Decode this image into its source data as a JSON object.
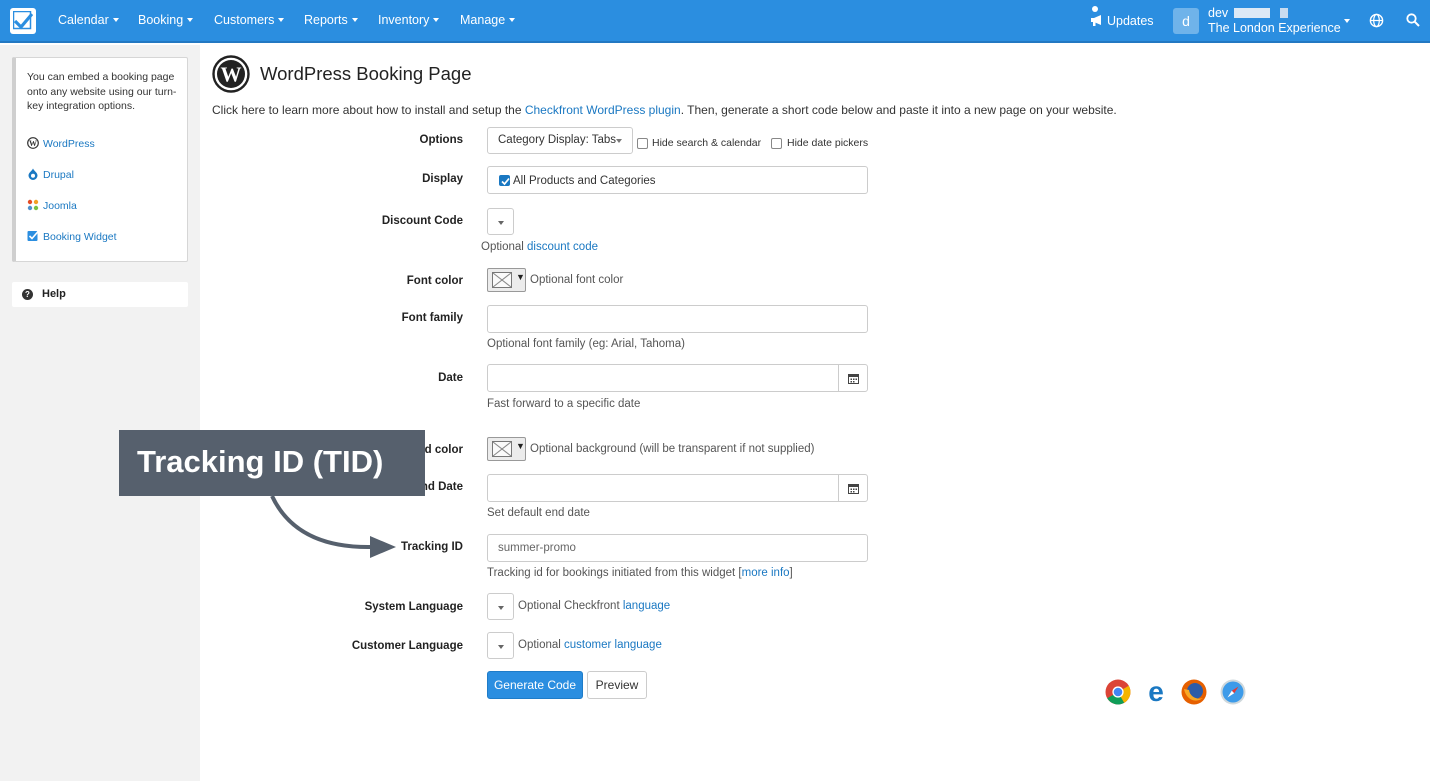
{
  "nav": {
    "items": [
      "Calendar",
      "Booking",
      "Customers",
      "Reports",
      "Inventory",
      "Manage"
    ],
    "updates_label": "Updates",
    "user_initial": "d",
    "user_name": "dev",
    "account_name": "The London Experience"
  },
  "sidebar": {
    "intro": "You can embed a booking page onto any website using our turn-key integration options.",
    "links": [
      "WordPress",
      "Drupal",
      "Joomla",
      "Booking Widget"
    ],
    "help_label": "Help"
  },
  "page": {
    "title": "WordPress Booking Page",
    "intro_before": "Click here to learn more about how to install and setup the ",
    "intro_link": "Checkfront WordPress plugin",
    "intro_after": ". Then, generate a short code below and paste it into a new page on your website."
  },
  "form": {
    "options_label": "Options",
    "options_select": "Category Display: Tabs",
    "hide_search_label": "Hide search & calendar",
    "hide_dates_label": "Hide date pickers",
    "display_label": "Display",
    "display_value": "All Products and Categories",
    "discount_label": "Discount Code",
    "discount_help_prefix": "Optional ",
    "discount_help_link": "discount code",
    "font_color_label": "Font color",
    "font_color_help": "Optional font color",
    "font_family_label": "Font family",
    "font_family_help": "Optional font family (eg: Arial, Tahoma)",
    "date_label": "Date",
    "date_help": "Fast forward to a specific date",
    "bg_color_label": "Background color",
    "bg_color_help": "Optional background (will be transparent if not supplied)",
    "end_date_label": "End Date",
    "end_date_help": "Set default end date",
    "tracking_label": "Tracking ID",
    "tracking_value": "summer-promo",
    "tracking_help_prefix": "Tracking id for bookings initiated from this widget [",
    "tracking_help_link": "more info",
    "tracking_help_suffix": "]",
    "system_lang_label": "System Language",
    "system_lang_prefix": "Optional Checkfront ",
    "system_lang_link": "language",
    "customer_lang_label": "Customer Language",
    "customer_lang_prefix": "Optional ",
    "customer_lang_link": "customer language",
    "generate_button": "Generate Code",
    "preview_button": "Preview"
  },
  "callout": {
    "text": "Tracking ID (TID)"
  },
  "colors": {
    "nav_bg": "#2b8ee0",
    "link": "#1a78c2",
    "callout_bg": "#56606d"
  },
  "browser_icons": [
    "chrome-icon",
    "edge-icon",
    "firefox-icon",
    "safari-icon"
  ]
}
